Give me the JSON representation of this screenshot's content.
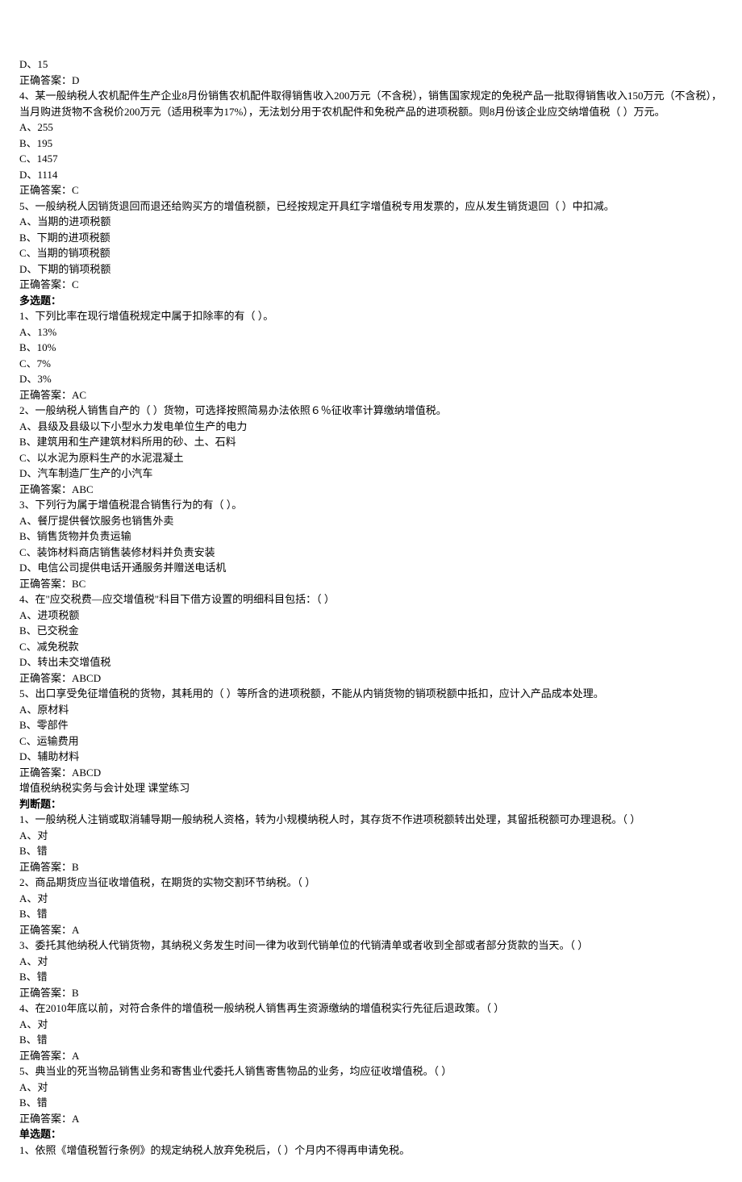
{
  "q3d": "D、15",
  "q3ans": "正确答案：D",
  "q4": "4、某一般纳税人农机配件生产企业8月份销售农机配件取得销售收入200万元（不含税），销售国家规定的免税产品一批取得销售收入150万元（不含税），当月购进货物不含税价200万元（适用税率为17%），无法划分用于农机配件和免税产品的进项税额。则8月份该企业应交纳增值税（  ）万元。",
  "q4a": "A、255",
  "q4b": "B、195",
  "q4c": "C、1457",
  "q4d": "D、1114",
  "q4ans": "正确答案：C",
  "q5": "5、一般纳税人因销货退回而退还给购买方的增值税额，已经按规定开具红字增值税专用发票的，应从发生销货退回（   ）中扣减。",
  "q5a": "A、当期的进项税额",
  "q5b": "B、下期的进项税额",
  "q5c": "C、当期的销项税额",
  "q5d": "D、下期的销项税额",
  "q5ans": "正确答案：C",
  "mh": "多选题：",
  "m1": "1、下列比率在现行增值税规定中属于扣除率的有（  ）。",
  "m1a": "A、13%",
  "m1b": "B、10%",
  "m1c": "C、7%",
  "m1d": "D、3%",
  "m1ans": "正确答案：AC",
  "m2": "2、一般纳税人销售自产的（   ）货物，可选择按照简易办法依照６％征收率计算缴纳增值税。",
  "m2a": "A、县级及县级以下小型水力发电单位生产的电力",
  "m2b": "B、建筑用和生产建筑材料所用的砂、土、石料",
  "m2c": "C、以水泥为原料生产的水泥混凝土",
  "m2d": "D、汽车制造厂生产的小汽车",
  "m2ans": "正确答案：ABC",
  "m3": "3、下列行为属于增值税混合销售行为的有（  ）。",
  "m3a": "A、餐厅提供餐饮服务也销售外卖",
  "m3b": "B、销售货物并负责运输",
  "m3c": "C、装饰材料商店销售装修材料并负责安装",
  "m3d": "D、电信公司提供电话开通服务并赠送电话机",
  "m3ans": "正确答案：BC",
  "m4": "4、在\"应交税费—应交增值税\"科目下借方设置的明细科目包括：（  ）",
  "m4a": "A、进项税额",
  "m4b": "B、已交税金",
  "m4c": "C、减免税款",
  "m4d": "D、转出未交增值税",
  "m4ans": "正确答案：ABCD",
  "m5": "5、出口享受免征增值税的货物，其耗用的（  ）等所含的进项税额，不能从内销货物的销项税额中抵扣，应计入产品成本处理。",
  "m5a": "A、原材料",
  "m5b": "B、零部件",
  "m5c": "C、运输费用",
  "m5d": "D、辅助材料",
  "m5ans": "正确答案：ABCD",
  "sec2": " 增值税纳税实务与会计处理  课堂练习",
  "jh": "判断题：",
  "j1": "1、一般纳税人注销或取消辅导期一般纳税人资格，转为小规模纳税人时，其存货不作进项税额转出处理，其留抵税额可办理退税。（   ）",
  "ja": "A、对",
  "jb": "B、错",
  "j1ans": "正确答案：B",
  "j2": "2、商品期货应当征收增值税，在期货的实物交割环节纳税。（  ）",
  "j2ans": "正确答案：A",
  "j3": "3、委托其他纳税人代销货物，其纳税义务发生时间一律为收到代销单位的代销清单或者收到全部或者部分货款的当天。（  ）",
  "j3ans": "正确答案：B",
  "j4": "4、在2010年底以前，对符合条件的增值税一般纳税人销售再生资源缴纳的增值税实行先征后退政策。（  ）",
  "j4ans": "正确答案：A",
  "j5": "5、典当业的死当物品销售业务和寄售业代委托人销售寄售物品的业务，均应征收增值税。（   ）",
  "j5ans": "正确答案：A",
  "sh": "单选题：",
  "s1": "1、依照《增值税暂行条例》的规定纳税人放弃免税后，（   ）个月内不得再申请免税。"
}
